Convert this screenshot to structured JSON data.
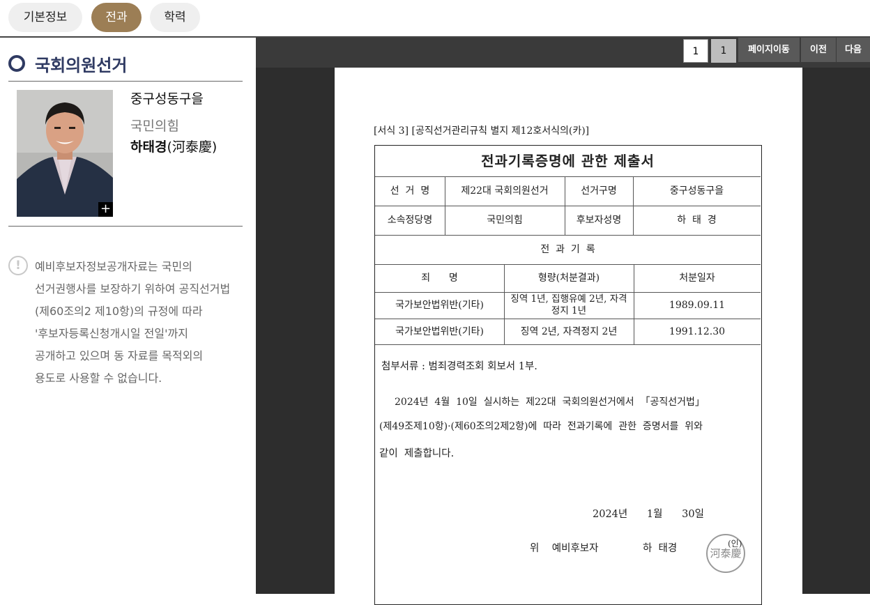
{
  "tabs": [
    {
      "label": "기본정보",
      "active": false
    },
    {
      "label": "전과",
      "active": true
    },
    {
      "label": "학력",
      "active": false
    }
  ],
  "sidebar": {
    "section_title": "국회의원선거",
    "candidate": {
      "district": "중구성동구을",
      "party": "국민의힘",
      "name": "하태경",
      "name_hanja": "(河泰慶)",
      "photo_expand": "+"
    },
    "notice_lines": [
      "예비후보자정보공개자료는 국민의",
      "선거권행사를 보장하기 위하여 공직선거법",
      "(제60조의2 제10항)의 규정에 따라",
      "'후보자등록신청개시일 전일'까지",
      "공개하고 있으며 동 자료를 목적외의",
      "용도로 사용할 수 없습니다."
    ],
    "notice_icon": "!"
  },
  "viewer": {
    "page_input": "1",
    "page_total": "1",
    "go_label": "페이지이동",
    "prev_label": "이전",
    "next_label": "다음"
  },
  "document": {
    "form_ref": "[서식 3] [공직선거관리규칙 별지 제12호서식의(카)]",
    "title": "전과기록증명에 관한 제출서",
    "election_label": "선  거  명",
    "election_value": "제22대 국회의원선거",
    "district_label": "선거구명",
    "district_value": "중구성동구을",
    "party_label": "소속정당명",
    "party_value": "국민의힘",
    "candidate_label": "후보자성명",
    "candidate_value": "하  태  경",
    "record_header": "전  과  기  록",
    "col_crime": "죄      명",
    "col_penalty": "형량(처분결과)",
    "col_date": "처분일자",
    "records": [
      {
        "crime": "국가보안법위반(기타)",
        "penalty": "징역 1년, 집행유예 2년, 자격정지 1년",
        "date": "1989.09.11"
      },
      {
        "crime": "국가보안법위반(기타)",
        "penalty": "징역 2년, 자격정지 2년",
        "date": "1991.12.30"
      }
    ],
    "attachment": "첨부서류 : 범죄경력조회 회보서 1부.",
    "body_lines": [
      "2024년  4월  10일  실시하는  제22대  국회의원선거에서  「공직선거법」",
      "(제49조제10항)·(제60조의2제2항)에  따라  전과기록에  관한  증명서를  위와",
      "같이  제출합니다."
    ],
    "date_line": "2024년      1월      30일",
    "signer_label": "위    예비후보자",
    "signer_name": "하  태경",
    "seal_text": "河泰慶",
    "seal_mark": "(인)"
  }
}
